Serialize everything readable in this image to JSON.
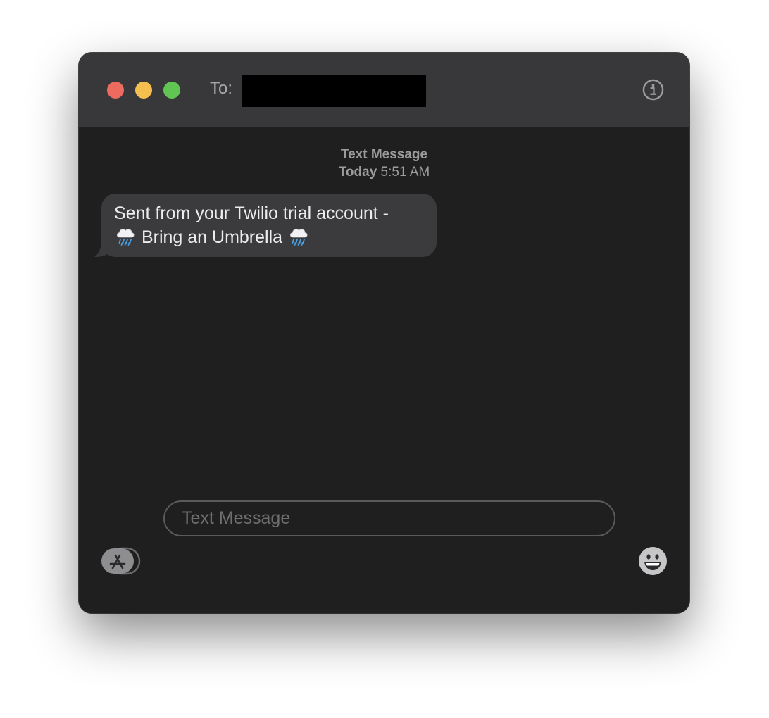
{
  "window": {
    "to_label": "To:",
    "recipient_redacted": true
  },
  "conversation": {
    "service": "Text Message",
    "timestamp_day": "Today",
    "timestamp_time": "5:51 AM",
    "messages": [
      {
        "direction": "incoming",
        "line1": "Sent from your Twilio trial account -",
        "line2": "Bring an Umbrella",
        "emoji": "cloud-with-rain-icon"
      }
    ]
  },
  "composer": {
    "placeholder": "Text Message",
    "value": ""
  },
  "colors": {
    "close": "#ed6a5e",
    "minimize": "#f5bf4f",
    "maximize": "#61c554",
    "bubble": "#3b3b3d"
  }
}
